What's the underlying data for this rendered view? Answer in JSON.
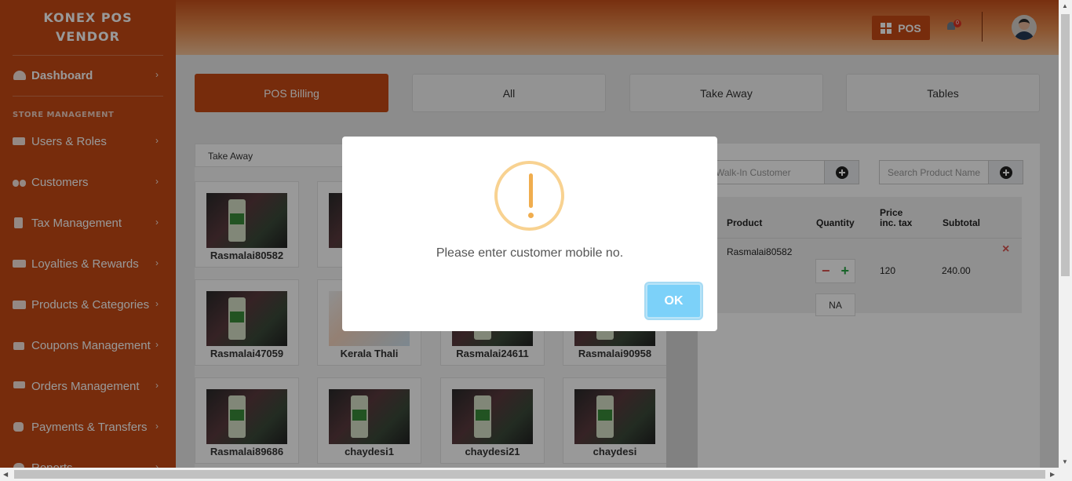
{
  "brand": {
    "line1": "KONEX POS",
    "line2": "VENDOR"
  },
  "sidebar": {
    "section_label": "STORE MANAGEMENT",
    "items": [
      {
        "label": "Dashboard",
        "icon": "gauge-icon",
        "active": true
      },
      {
        "label": "Users & Roles",
        "icon": "user-roles-icon"
      },
      {
        "label": "Customers",
        "icon": "users-icon"
      },
      {
        "label": "Tax Management",
        "icon": "calculator-icon"
      },
      {
        "label": "Loyalties & Rewards",
        "icon": "credit-card-icon"
      },
      {
        "label": "Products & Categories",
        "icon": "store-icon"
      },
      {
        "label": "Coupons Management",
        "icon": "briefcase-icon"
      },
      {
        "label": "Orders Management",
        "icon": "cart-icon"
      },
      {
        "label": "Payments & Transfers",
        "icon": "coins-icon"
      },
      {
        "label": "Reports",
        "icon": "chart-icon"
      }
    ],
    "chevron": "›"
  },
  "header": {
    "pos_label": "POS",
    "notification_count": "0"
  },
  "tabs": [
    {
      "label": "POS Billing",
      "active": true
    },
    {
      "label": "All"
    },
    {
      "label": "Take Away"
    },
    {
      "label": "Tables"
    }
  ],
  "order_type": "Take Away",
  "products": [
    {
      "name": "Rasmalai80582"
    },
    {
      "name": ""
    },
    {
      "name": ""
    },
    {
      "name": ""
    },
    {
      "name": "Rasmalai47059"
    },
    {
      "name": "Kerala Thali"
    },
    {
      "name": "Rasmalai24611"
    },
    {
      "name": "Rasmalai90958"
    },
    {
      "name": "Rasmalai89686"
    },
    {
      "name": "chaydesi1"
    },
    {
      "name": "chaydesi21"
    },
    {
      "name": "chaydesi"
    }
  ],
  "customer_search": {
    "placeholder": "Walk-In Customer"
  },
  "product_search": {
    "placeholder": "Search Product Name"
  },
  "cart": {
    "headers": {
      "product": "Product",
      "quantity": "Quantity",
      "price_line1": "Price",
      "price_line2": "inc. tax",
      "subtotal": "Subtotal"
    },
    "rows": [
      {
        "product": "Rasmalai80582",
        "minus": "−",
        "plus": "+",
        "price": "120",
        "subtotal": "240.00",
        "remove": "×",
        "note": "NA"
      }
    ]
  },
  "modal": {
    "message": "Please enter customer mobile no.",
    "ok_label": "OK"
  },
  "colors": {
    "brand": "#c64a15",
    "modal_ok": "#7cd1f9",
    "warning": "#f0ad4e"
  }
}
